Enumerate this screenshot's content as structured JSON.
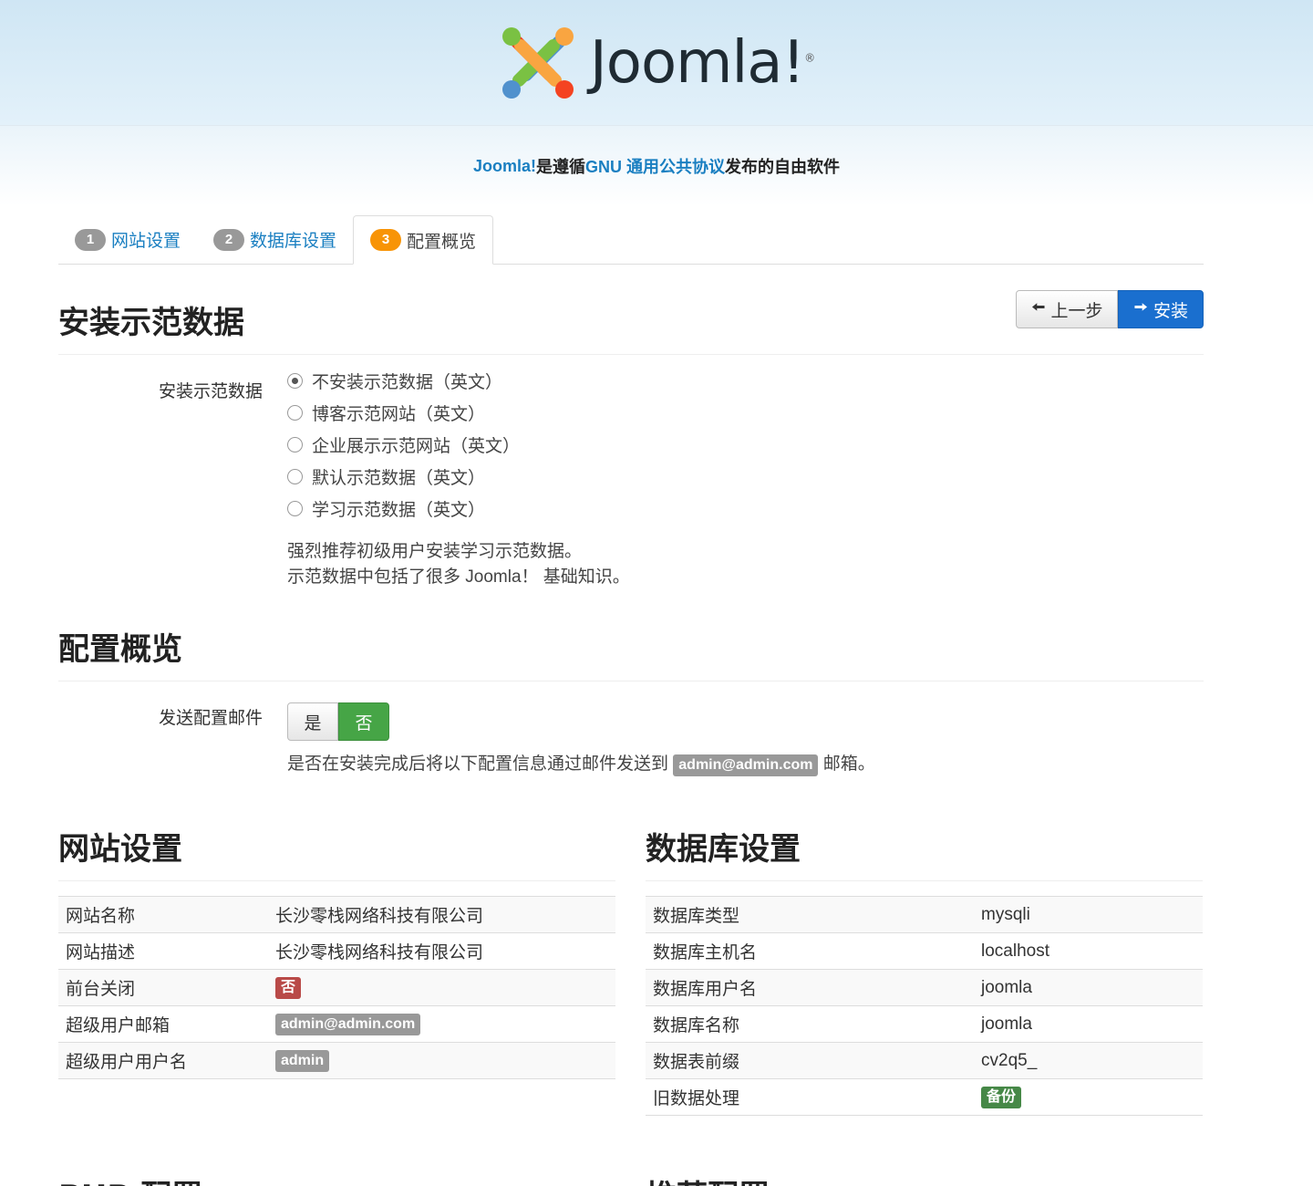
{
  "header": {
    "logo_text": "Joomla!",
    "reg_mark": "®"
  },
  "tagline": {
    "part1": "Joomla!",
    "part2": " 是遵循 ",
    "part3": "GNU 通用公共协议",
    "part4": " 发布的自由软件"
  },
  "tabs": [
    {
      "num": "1",
      "label": "网站设置"
    },
    {
      "num": "2",
      "label": "数据库设置"
    },
    {
      "num": "3",
      "label": "配置概览"
    }
  ],
  "sample": {
    "heading": "安装示范数据",
    "field_label": "安装示范数据",
    "options": [
      "不安装示范数据（英文）",
      "博客示范网站（英文）",
      "企业展示示范网站（英文）",
      "默认示范数据（英文）",
      "学习示范数据（英文）"
    ],
    "help_line1": "强烈推荐初级用户安装学习示范数据。",
    "help_line2": "示范数据中包括了很多 Joomla！ 基础知识。"
  },
  "buttons": {
    "prev": "上一步",
    "install": "安装"
  },
  "overview": {
    "heading": "配置概览",
    "email_label": "发送配置邮件",
    "yes": "是",
    "no": "否",
    "email_help_pre": "是否在安装完成后将以下配置信息通过邮件发送到 ",
    "email_addr": "admin@admin.com",
    "email_help_post": " 邮箱。"
  },
  "site": {
    "heading": "网站设置",
    "rows": [
      {
        "key": "网站名称",
        "value": "长沙零栈网络科技有限公司"
      },
      {
        "key": "网站描述",
        "value": "长沙零栈网络科技有限公司"
      },
      {
        "key": "前台关闭",
        "value": "否"
      },
      {
        "key": "超级用户邮箱",
        "value": "admin@admin.com"
      },
      {
        "key": "超级用户用户名",
        "value": "admin"
      }
    ]
  },
  "db": {
    "heading": "数据库设置",
    "rows": [
      {
        "key": "数据库类型",
        "value": "mysqli"
      },
      {
        "key": "数据库主机名",
        "value": "localhost"
      },
      {
        "key": "数据库用户名",
        "value": "joomla"
      },
      {
        "key": "数据库名称",
        "value": "joomla"
      },
      {
        "key": "数据表前缀",
        "value": "cv2q5_"
      },
      {
        "key": "旧数据处理",
        "value": "备份"
      }
    ]
  },
  "bottom": {
    "php_heading": "PHP 配置",
    "rec_heading": "推荐配置"
  },
  "colors": {
    "accent": "#1a7fc1",
    "install_btn": "#1a6fcf",
    "success": "#46a546",
    "danger": "#b94a48",
    "warning": "#f89406"
  }
}
